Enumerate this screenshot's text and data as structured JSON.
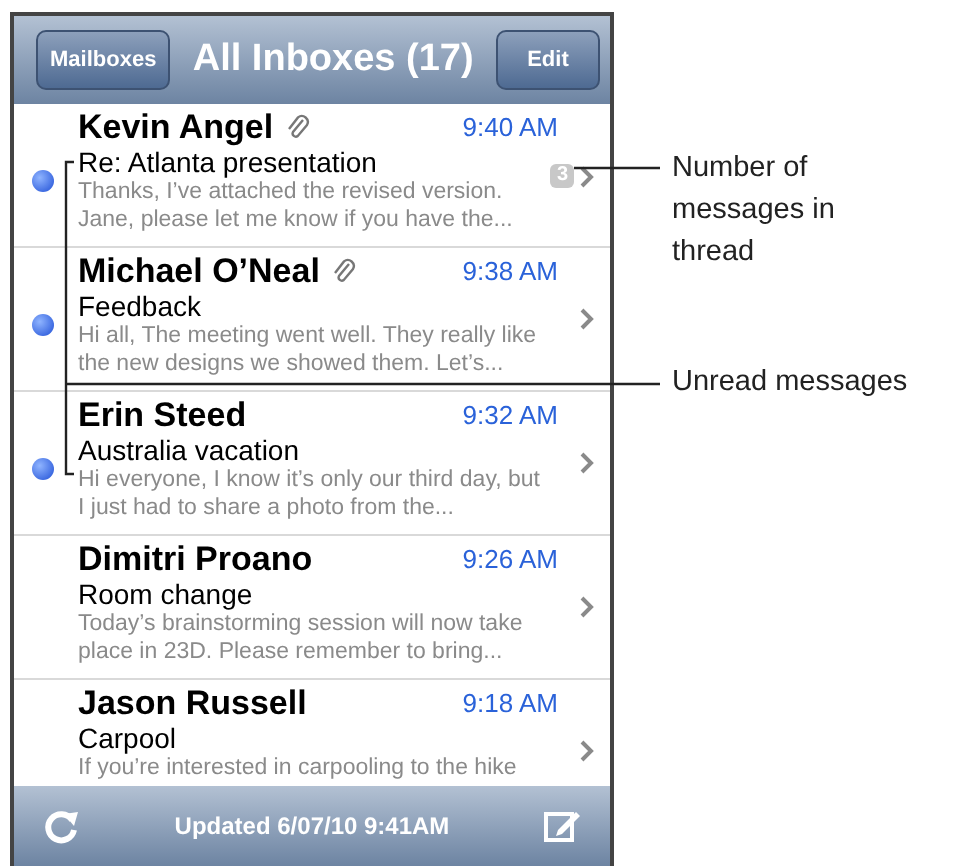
{
  "nav_bar": {
    "back_button": "Mailboxes",
    "title": "All Inboxes (17)",
    "edit_button": "Edit"
  },
  "messages": [
    {
      "sender": "Kevin Angel",
      "attachment": true,
      "time": "9:40 AM",
      "subject": "Re: Atlanta presentation",
      "preview": "Thanks, I’ve attached the revised version. Jane, please let me know if you have the...",
      "unread": true,
      "thread_count": "3"
    },
    {
      "sender": "Michael O’Neal",
      "attachment": true,
      "time": "9:38 AM",
      "subject": "Feedback",
      "preview": "Hi all, The meeting went well. They really like the new designs we showed them. Let’s...",
      "unread": true
    },
    {
      "sender": "Erin Steed",
      "attachment": false,
      "time": "9:32 AM",
      "subject": "Australia vacation",
      "preview": "Hi everyone, I know it’s only our third day, but I just had to share a photo from the...",
      "unread": true
    },
    {
      "sender": "Dimitri Proano",
      "attachment": false,
      "time": "9:26 AM",
      "subject": "Room change",
      "preview": "Today’s brainstorming session will now take place in 23D. Please remember to bring...",
      "unread": false
    },
    {
      "sender": "Jason Russell",
      "attachment": false,
      "time": "9:18 AM",
      "subject": "Carpool",
      "preview": "If you’re interested in carpooling to the hike",
      "unread": false
    }
  ],
  "toolbar": {
    "status": "Updated 6/07/10 9:41AM"
  },
  "callouts": [
    "Number of messages in thread",
    "Unread messages"
  ]
}
